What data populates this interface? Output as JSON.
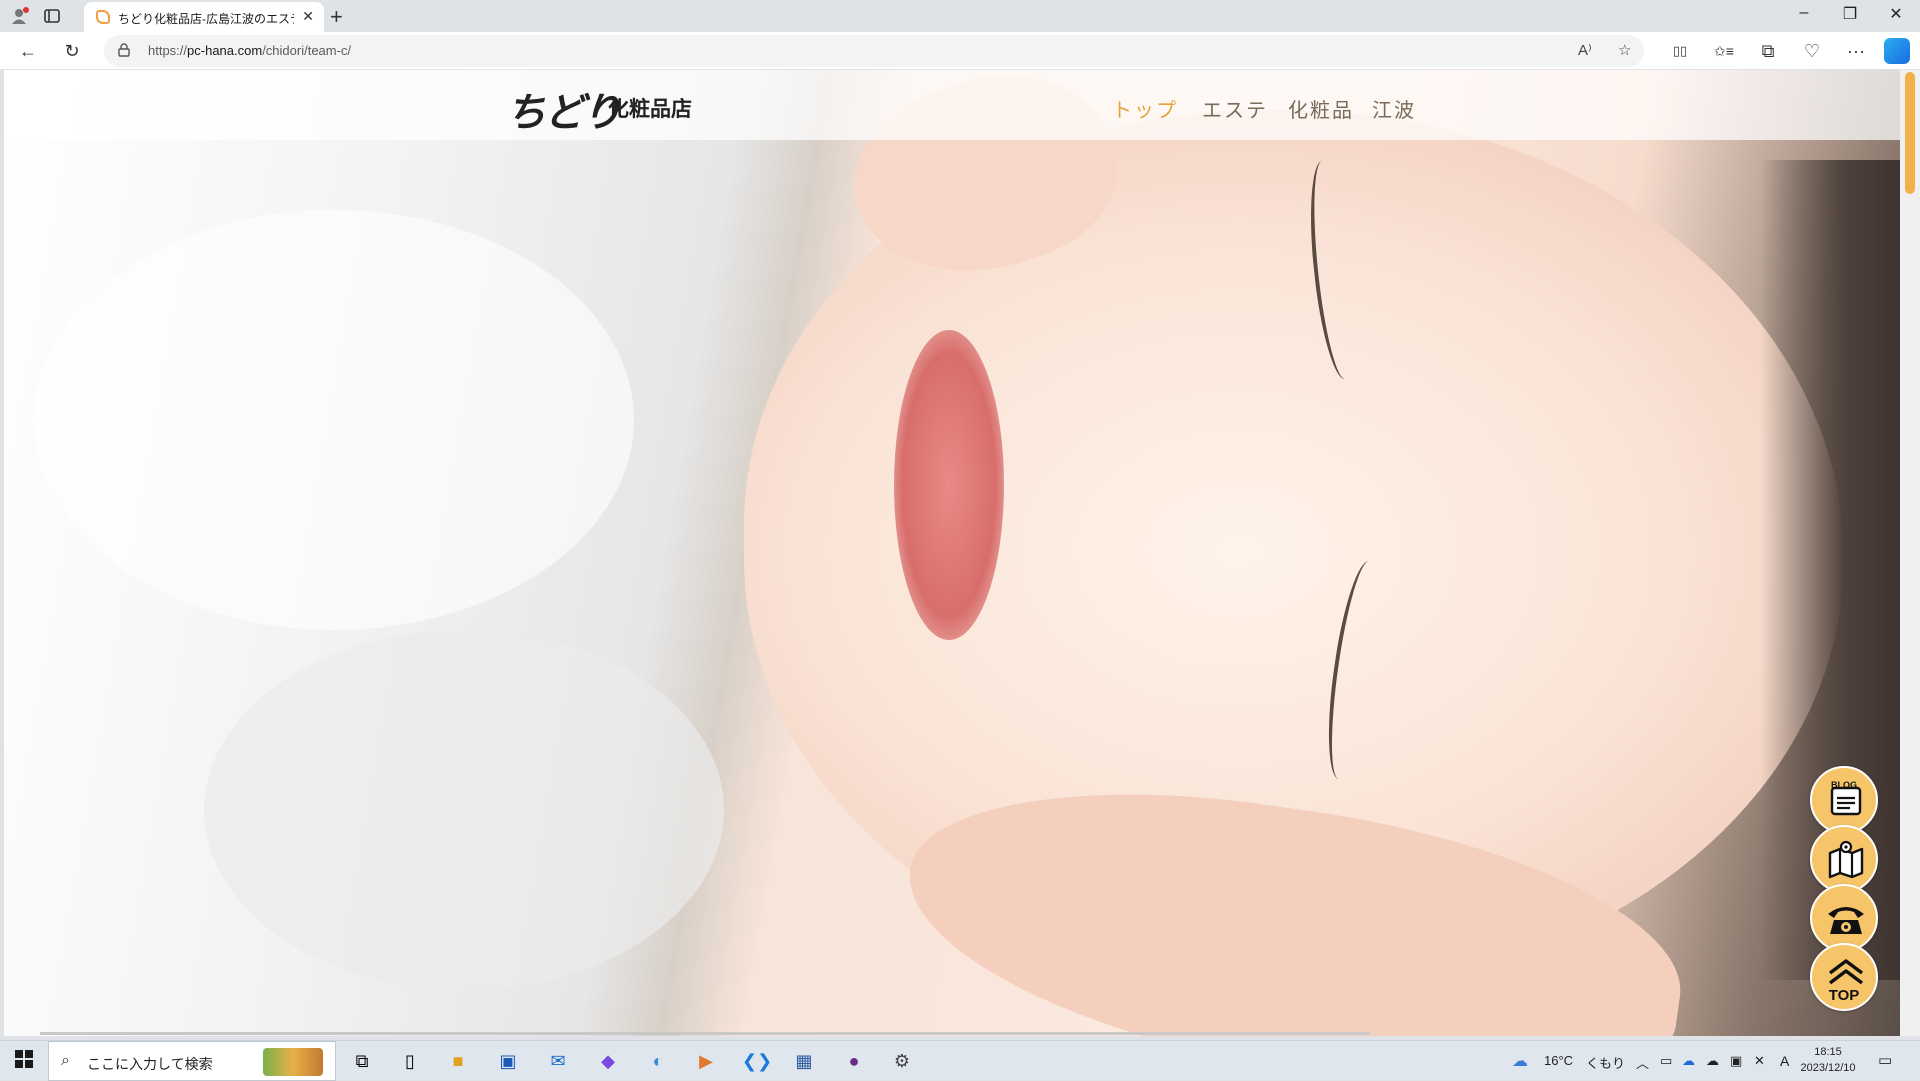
{
  "browser": {
    "tab": {
      "title": "ちどり化粧品店-広島江波のエステ・化粧品",
      "favicon": "site-favicon"
    },
    "new_tab_label": "+",
    "window_controls": {
      "minimize": "–",
      "restore": "❐",
      "close": "✕"
    },
    "address": {
      "scheme": "https://",
      "host": "pc-hana.com",
      "path": "/chidori/team-c/"
    },
    "buttons": {
      "back": "←",
      "reload": "↻",
      "read_aloud": "A⁾",
      "favorite": "☆",
      "split": "▯▯",
      "favorites": "✩≡",
      "collections": "⧉",
      "extensions": "♡",
      "more": "···"
    }
  },
  "site": {
    "logo_script": "ちどり",
    "logo_text": "化粧品店",
    "nav": [
      {
        "label": "トップ",
        "active": true
      },
      {
        "label": "エステ",
        "active": false
      },
      {
        "label": "化粧品",
        "active": false
      },
      {
        "label": "江波",
        "active": false
      }
    ],
    "floating_buttons": [
      {
        "id": "blog",
        "label": "BLOG",
        "icon": "blog-icon"
      },
      {
        "id": "map",
        "label": "",
        "icon": "map-icon"
      },
      {
        "id": "phone",
        "label": "",
        "icon": "phone-icon"
      },
      {
        "id": "top",
        "label": "TOP",
        "icon": "chevron-up-icon"
      }
    ],
    "accent_color": "#e8a23c",
    "fab_color": "#f6c56a"
  },
  "taskbar": {
    "search_placeholder": "ここに入力して検索",
    "weather": {
      "temp": "16°C",
      "condition": "くもり"
    },
    "ime": "A",
    "clock": {
      "time": "18:15",
      "date": "2023/12/10"
    }
  }
}
